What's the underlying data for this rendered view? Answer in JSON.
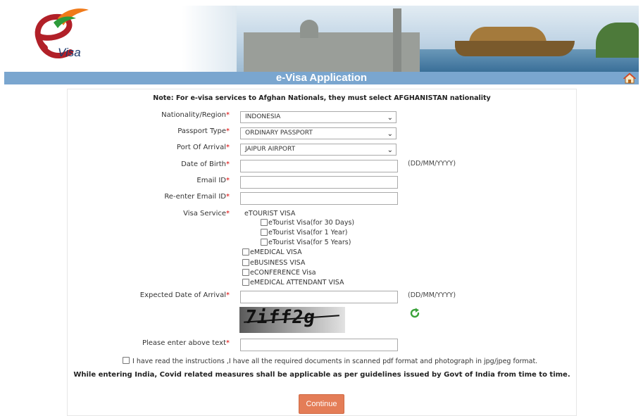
{
  "header": {
    "title": "e-Visa Application",
    "logo_text": "Visa"
  },
  "form": {
    "note": "Note: For e-visa services to Afghan Nationals, they must select AFGHANISTAN nationality",
    "required_mark": "*",
    "nationality": {
      "label": "Nationality/Region",
      "value": "INDONESIA"
    },
    "passport_type": {
      "label": "Passport Type",
      "value": "ORDINARY PASSPORT"
    },
    "port_of_arrival": {
      "label": "Port Of Arrival",
      "value": "JAIPUR AIRPORT"
    },
    "date_of_birth": {
      "label": "Date of Birth",
      "value": "",
      "hint": "(DD/MM/YYYY)"
    },
    "email": {
      "label": "Email ID",
      "value": ""
    },
    "reenter_email": {
      "label": "Re-enter Email ID",
      "value": ""
    },
    "visa_service": {
      "label": "Visa Service",
      "etourist_heading": "eTOURIST VISA",
      "etourist_options": [
        {
          "label": "eTourist Visa(for 30 Days)",
          "checked": false
        },
        {
          "label": "eTourist Visa(for 1 Year)",
          "checked": false
        },
        {
          "label": "eTourist Visa(for 5 Years)",
          "checked": false
        }
      ],
      "other_options": [
        {
          "label": "eMEDICAL VISA",
          "checked": false
        },
        {
          "label": "eBUSINESS VISA",
          "checked": false
        },
        {
          "label": "eCONFERENCE Visa",
          "checked": false
        },
        {
          "label": "eMEDICAL ATTENDANT VISA",
          "checked": false
        }
      ]
    },
    "expected_arrival": {
      "label": "Expected Date of Arrival",
      "value": "",
      "hint": "(DD/MM/YYYY)"
    },
    "captcha": {
      "text": "7iff2g"
    },
    "captcha_input": {
      "label": "Please enter above text",
      "value": ""
    },
    "declaration": {
      "label": "I have read the instructions ,I have all the required documents in scanned pdf format and photograph in jpg/jpeg format.",
      "checked": false
    },
    "covid_notice": "While entering India, Covid related measures shall be applicable as per guidelines issued by Govt of India from time to time.",
    "continue_label": "Continue"
  },
  "colors": {
    "title_bar": "#7aa6cf",
    "required": "#dd0000",
    "button": "#e47d57",
    "refresh_icon": "#3aa23a"
  }
}
